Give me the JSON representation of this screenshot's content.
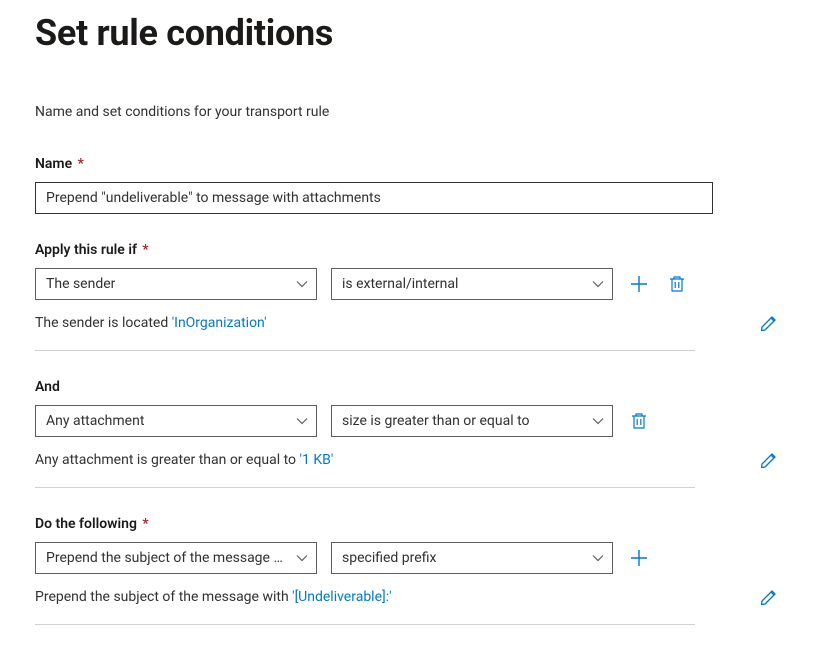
{
  "page_title": "Set rule conditions",
  "intro": "Name and set conditions for your transport rule",
  "name": {
    "label": "Name",
    "value": "Prepend \"undeliverable\" to message with attachments"
  },
  "apply_if": {
    "label": "Apply this rule if",
    "left": "The sender",
    "right": "is external/internal",
    "summary_prefix": "The sender is located ",
    "summary_value": "'InOrganization'"
  },
  "and_block": {
    "label": "And",
    "left": "Any attachment",
    "right": "size is greater than or equal to",
    "summary_prefix": "Any attachment is greater than or equal to ",
    "summary_value": "'1 KB'"
  },
  "do_following": {
    "label": "Do the following",
    "left": "Prepend the subject of the message w…",
    "right": "specified prefix",
    "summary_prefix": "Prepend the subject of the message with ",
    "summary_value": "'[Undeliverable]:'"
  },
  "colors": {
    "accent": "#0078d4"
  }
}
